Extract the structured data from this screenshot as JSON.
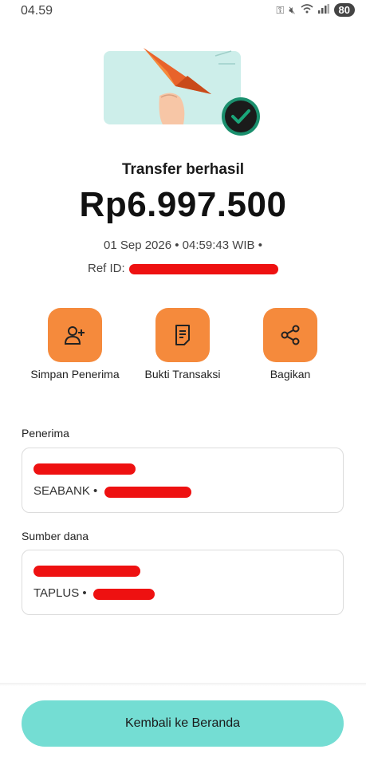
{
  "status_bar": {
    "time": "04.59",
    "battery": "80"
  },
  "header": {
    "title": "Transfer berhasil",
    "amount": "Rp6.997.500",
    "datetime": "01 Sep 2026 • 04:59:43 WIB •",
    "ref_label": "Ref ID:"
  },
  "actions": [
    {
      "label": "Simpan Penerima",
      "icon": "add-user-icon"
    },
    {
      "label": "Bukti Transaksi",
      "icon": "receipt-icon"
    },
    {
      "label": "Bagikan",
      "icon": "share-icon"
    }
  ],
  "recipient": {
    "section_label": "Penerima",
    "bank_prefix": "SEABANK •"
  },
  "source": {
    "section_label": "Sumber dana",
    "bank_prefix": "TAPLUS •"
  },
  "footer": {
    "home_label": "Kembali ke Beranda"
  },
  "colors": {
    "accent_orange": "#f58a3c",
    "teal_button": "#74ddd3",
    "redaction": "#ee1111",
    "success_check": "#1aa67a"
  }
}
